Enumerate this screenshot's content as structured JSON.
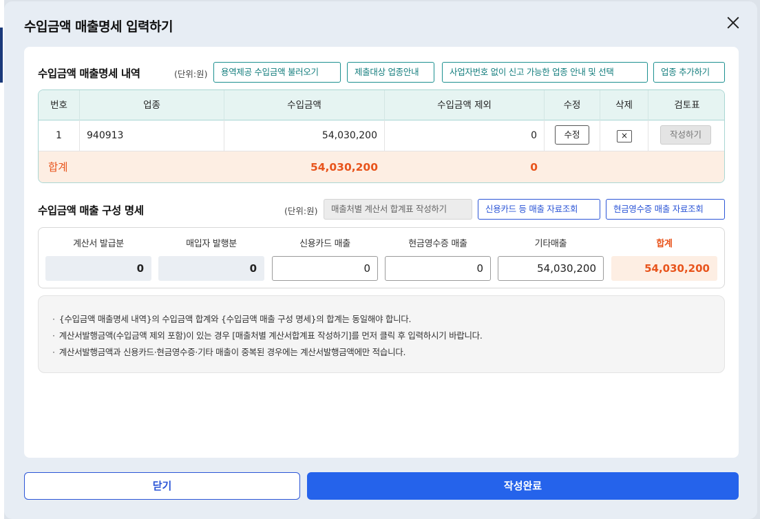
{
  "dialog": {
    "title": "수입금액 매출명세 입력하기",
    "close_label": "닫기",
    "submit_label": "작성완료"
  },
  "section1": {
    "title": "수입금액 매출명세 내역",
    "unit": "(단위:원)",
    "buttons": [
      "용역제공 수입금액 불러오기",
      "제출대상 업종안내",
      "사업자번호 없이 신고 가능한 업종 안내 및 선택",
      "업종 추가하기"
    ],
    "columns": [
      "번호",
      "업종",
      "수입금액",
      "수입금액 제외",
      "수정",
      "삭제",
      "검토표"
    ],
    "rows": [
      {
        "no": "1",
        "industry": "940913",
        "amount": "54,030,200",
        "excluded": "0",
        "edit": "수정",
        "delete": "×",
        "review": "작성하기"
      }
    ],
    "sum": {
      "label": "합계",
      "amount": "54,030,200",
      "excluded": "0"
    }
  },
  "section2": {
    "title": "수입금액 매출 구성 명세",
    "unit": "(단위:원)",
    "buttons": [
      "매출처별 계산서 합계표 작성하기",
      "신용카드 등 매출 자료조회",
      "현금영수증 매출 자료조회"
    ],
    "items": [
      {
        "label": "계산서 발급분",
        "value": "0"
      },
      {
        "label": "매입자 발행분",
        "value": "0"
      },
      {
        "label": "신용카드 매출",
        "value": "0"
      },
      {
        "label": "현금영수증 매출",
        "value": "0"
      },
      {
        "label": "기타매출",
        "value": "54,030,200"
      },
      {
        "label": "합계",
        "value": "54,030,200"
      }
    ]
  },
  "notes": [
    "{수입금액 매출명세 내역}의 수입금액 합계와 {수입금액 매출 구성 명세}의 합계는 동일해야 합니다.",
    "계산서발행금액(수입금액 제외 포함)이 있는 경우 [매출처별 계산서합계표 작성하기]를 먼저 클릭 후 입력하시기 바랍니다.",
    "계산서발행금액과 신용카드·현금영수증·기타 매출이 중복된 경우에는 계산서발행금액에만 적습니다."
  ],
  "colors": {
    "accent": "#2563eb",
    "teal": "#137d7d",
    "sum": "#e8541c"
  }
}
